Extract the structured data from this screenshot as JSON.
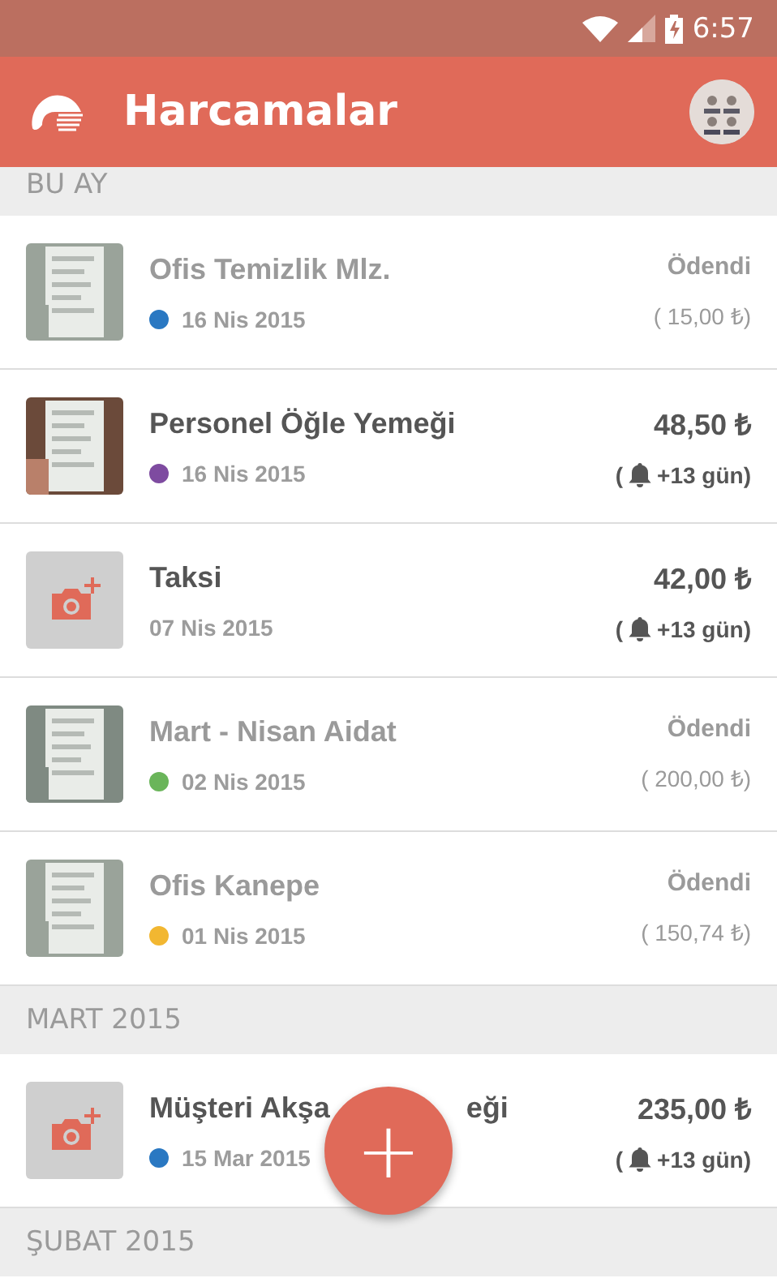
{
  "status_bar": {
    "time": "6:57"
  },
  "app_bar": {
    "title": "Harcamalar"
  },
  "sections": [
    {
      "title": "BU AY",
      "items": [
        {
          "title": "Ofis Temizlik Mlz.",
          "date": "16 Nis 2015",
          "color": "#2a78c2",
          "paid": true,
          "amount": "Ödendi",
          "note_before": "( 15,00 ₺)",
          "bell": false
        },
        {
          "title": "Personel Öğle Yemeği",
          "date": "16 Nis 2015",
          "color": "#7e4ba0",
          "paid": false,
          "amount": "48,50 ₺",
          "note_before": "(",
          "bell": true,
          "note_after": "+13 gün)"
        },
        {
          "kind": "no-photo",
          "title": "Taksi",
          "date": "07 Nis 2015",
          "paid": false,
          "amount": "42,00 ₺",
          "note_before": "(",
          "bell": true,
          "note_after": "+13 gün)"
        },
        {
          "title": "Mart - Nisan Aidat",
          "date": "02 Nis 2015",
          "color": "#6ab55a",
          "paid": true,
          "amount": "Ödendi",
          "note_before": "( 200,00 ₺)",
          "bell": false
        },
        {
          "title": "Ofis Kanepe",
          "date": "01 Nis 2015",
          "color": "#f2b731",
          "paid": true,
          "amount": "Ödendi",
          "note_before": "( 150,74 ₺)",
          "bell": false
        }
      ]
    },
    {
      "title": "MART 2015",
      "items": [
        {
          "kind": "no-photo",
          "title_parts": [
            "Müşteri Akşa",
            "eği"
          ],
          "date": "15 Mar 2015",
          "color": "#2a78c2",
          "paid": false,
          "amount": "235,00 ₺",
          "note_before": "(",
          "bell": true,
          "note_after": "+13 gün)"
        }
      ]
    },
    {
      "title": "ŞUBAT 2015"
    }
  ],
  "fab": {
    "label": "+"
  }
}
